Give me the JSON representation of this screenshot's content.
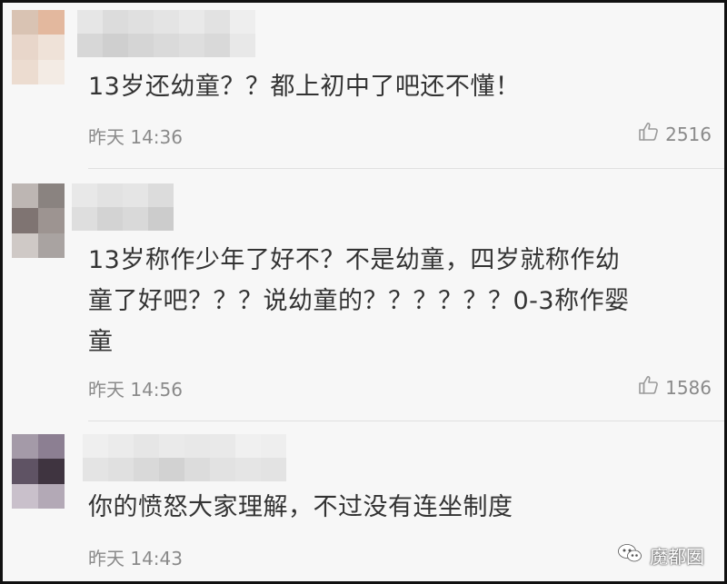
{
  "comments": [
    {
      "text": "13岁还幼童？？都上初中了吧还不懂！",
      "time": "昨天 14:36",
      "likes": "2516",
      "avatar_colors": [
        "#d9c3b3",
        "#e3b89e",
        "#e8d6ca",
        "#efe2d8",
        "#ecdcd0",
        "#f3ebe4"
      ],
      "nick_colors": [
        "#e6e6e6",
        "#d7d7d7",
        "#dcdcdc",
        "#cfcfcf",
        "#e0e0e0",
        "#d5d5d5",
        "#e4e4e4",
        "#dadada",
        "#e9e9e9",
        "#dedede",
        "#e2e2e2",
        "#d9d9d9",
        "#eeeeee",
        "#e8e8e8"
      ]
    },
    {
      "text": "13岁称作少年了好不？不是幼童，四岁就称作幼\n童了好吧？？？说幼童的？？？？？？0-3称作婴\n童",
      "time": "昨天 14:56",
      "likes": "1586",
      "avatar_colors": [
        "#bdb6b3",
        "#8a8380",
        "#7f7472",
        "#9d9491",
        "#cfc9c6",
        "#a9a3a1"
      ],
      "nick_colors": [
        "#e8e8e8",
        "#dedede",
        "#e2e2e2",
        "#d3d3d3",
        "#e5e5e5",
        "#d9d9d9",
        "#dcdcdc",
        "#cccccc"
      ]
    },
    {
      "text": "你的愤怒大家理解，不过没有连坐制度",
      "time": "昨天 14:43",
      "likes": "",
      "avatar_colors": [
        "#a49aa8",
        "#8c7f92",
        "#5f5364",
        "#3f3440",
        "#c9c0cb",
        "#b3a9b6"
      ],
      "nick_colors": [
        "#efefef",
        "#e4e4e4",
        "#ebebeb",
        "#e0e0e0",
        "#e6e6e6",
        "#d9d9d9",
        "#eaeaea",
        "#d2d2d2",
        "#e8e8e8",
        "#dcdcdc",
        "#e9e9e9",
        "#e2e2e2",
        "#f0f0f0",
        "#e5e5e5",
        "#eeeeee",
        "#e3e3e3"
      ]
    }
  ],
  "icons": {
    "like": "thumbs-up-icon",
    "watermark": "wechat-icon"
  },
  "watermark": {
    "text": "魔都囡"
  }
}
